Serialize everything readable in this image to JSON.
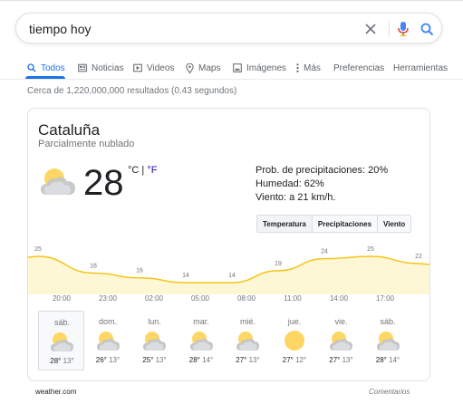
{
  "search": {
    "query": "tiempo hoy"
  },
  "tabs": [
    {
      "label": "Todos",
      "icon": "search-icon"
    },
    {
      "label": "Noticias",
      "icon": "news-icon"
    },
    {
      "label": "Videos",
      "icon": "video-icon"
    },
    {
      "label": "Maps",
      "icon": "map-pin-icon"
    },
    {
      "label": "Imágenes",
      "icon": "image-icon"
    },
    {
      "label": "Más",
      "icon": "more-vert-icon"
    },
    {
      "label": "Preferencias"
    },
    {
      "label": "Herramientas"
    }
  ],
  "result_stats": "Cerca de 1,220,000,000 resultados (0.43 segundos)",
  "weather": {
    "location": "Cataluña",
    "condition": "Parcialmente nublado",
    "temperature": "28",
    "unit_c": "°C",
    "unit_sep": " | ",
    "unit_f": "°F",
    "precipitation": "Prob. de precipitaciones: 20%",
    "humidity": "Humedad: 62%",
    "wind": "Viento: a 21 km/h.",
    "chart_tabs": [
      "Temperatura",
      "Precipitaciones",
      "Viento"
    ],
    "hourly_temps": [
      25,
      18,
      16,
      14,
      14,
      19,
      24,
      25,
      22
    ],
    "times": [
      "20:00",
      "23:00",
      "02:00",
      "05:00",
      "08:00",
      "11:00",
      "14:00",
      "17:00"
    ],
    "days": [
      {
        "name": "sáb.",
        "hi": "28°",
        "lo": "13°",
        "icon": "partly-cloudy-icon"
      },
      {
        "name": "dom.",
        "hi": "26°",
        "lo": "13°",
        "icon": "partly-cloudy-icon"
      },
      {
        "name": "lun.",
        "hi": "25°",
        "lo": "13°",
        "icon": "partly-cloudy-icon"
      },
      {
        "name": "mar.",
        "hi": "28°",
        "lo": "14°",
        "icon": "partly-cloudy-icon"
      },
      {
        "name": "mié.",
        "hi": "27°",
        "lo": "13°",
        "icon": "partly-cloudy-icon"
      },
      {
        "name": "jue.",
        "hi": "27°",
        "lo": "12°",
        "icon": "sunny-icon"
      },
      {
        "name": "vie.",
        "hi": "27°",
        "lo": "13°",
        "icon": "partly-cloudy-icon"
      },
      {
        "name": "sáb.",
        "hi": "28°",
        "lo": "14°",
        "icon": "partly-cloudy-icon"
      }
    ],
    "source": "weather.com",
    "feedback": "Comentarios"
  },
  "colors": {
    "accent": "#1a73e8",
    "chart_line": "#f5c518",
    "chart_fill": "#fef7d5",
    "sun": "#fdd663"
  }
}
